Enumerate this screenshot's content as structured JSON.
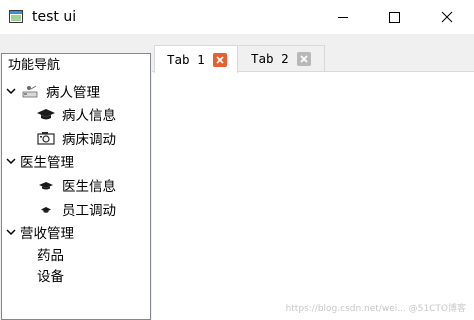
{
  "window": {
    "title": "test ui"
  },
  "nav": {
    "header": "功能导航",
    "groups": [
      {
        "label": "病人管理",
        "icon": "teacher-desk-icon",
        "children": [
          {
            "label": "病人信息",
            "icon": "graduation-cap-icon"
          },
          {
            "label": "病床调动",
            "icon": "camera-icon"
          }
        ]
      },
      {
        "label": "医生管理",
        "children": [
          {
            "label": "医生信息",
            "icon": "graduation-cap-small-icon"
          },
          {
            "label": "员工调动",
            "icon": "graduation-cap-tiny-icon"
          }
        ]
      },
      {
        "label": "营收管理",
        "children": [
          {
            "label": "药品"
          },
          {
            "label": "设备"
          }
        ]
      }
    ]
  },
  "tabs": [
    {
      "label": "Tab 1",
      "active": true
    },
    {
      "label": "Tab 2",
      "active": false
    }
  ],
  "watermark": "https://blog.csdn.net/wei...  @51CTO博客",
  "colors": {
    "active_close": "#e8602d",
    "inactive_close": "#b8b8b8",
    "border": "#828790"
  }
}
